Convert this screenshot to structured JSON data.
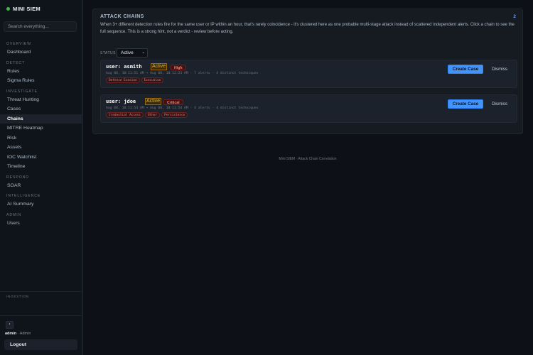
{
  "app": {
    "brand": "MINI SIEM",
    "brand_color": "#3fb950"
  },
  "search": {
    "placeholder": "Search everything..."
  },
  "nav": {
    "overview_label": "OVERVIEW",
    "dashboard": "Dashboard",
    "detect_label": "DETECT",
    "rules": "Rules",
    "sigma_rules": "Sigma Rules",
    "investigate_label": "INVESTIGATE",
    "threat_hunting": "Threat Hunting",
    "cases": "Cases",
    "chains": "Chains",
    "mitre_heatmap": "MITRE Heatmap",
    "risk": "Risk",
    "assets": "Assets",
    "ioc_watchlist": "IOC Watchlist",
    "timeline": "Timeline",
    "respond_label": "RESPOND",
    "soar": "SOAR",
    "intelligence_label": "INTELLIGENCE",
    "ai_summary": "AI Summary",
    "admin_label": "ADMIN",
    "users": "Users"
  },
  "sidebar_footer": {
    "ingestion_label": "INGESTION",
    "collapse_glyph": "‹",
    "username": "admin",
    "role": "· Admin",
    "logout": "Logout"
  },
  "panel": {
    "title": "ATTACK CHAINS",
    "count": "2",
    "description": "When 3+ different detection rules fire for the same user or IP within an hour, that's rarely coincidence - it's clustered here as one probable multi-stage attack instead of scattered independent alerts. Click a chain to see the full sequence. This is a strong hint, not a verdict - review before acting.",
    "status_label": "STATUS",
    "status_value": "Active",
    "status_caret": "⌄"
  },
  "chains": [
    {
      "user": "user: asmith",
      "state": "Active",
      "severity": "High",
      "meta": "Aug 08, 10:11:51 AM → Aug 08, 10:12:23 AM · 7 alerts · 4 distinct techniques",
      "tags": [
        "Defense Evasion",
        "Execution"
      ],
      "create_label": "Create Case",
      "dismiss_label": "Dismiss"
    },
    {
      "user": "user: jdoe",
      "state": "Active",
      "severity": "Critical",
      "meta": "Aug 08, 10:11:54 AM → Aug 08, 10:11:54 AM · 4 alerts · 4 distinct techniques",
      "tags": [
        "Credential Access",
        "Other",
        "Persistence"
      ],
      "create_label": "Create Case",
      "dismiss_label": "Dismiss"
    }
  ],
  "footer": {
    "text": "Mini SIEM · Attack Chain Correlation"
  }
}
